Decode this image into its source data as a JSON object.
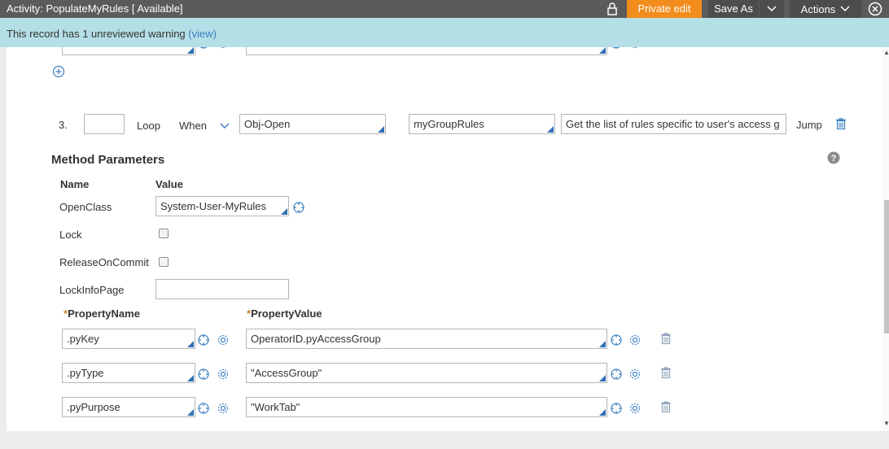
{
  "header": {
    "title": "Activity:  PopulateMyRules [ Available]",
    "private_edit": "Private edit",
    "save_as": "Save As",
    "actions": "Actions"
  },
  "warning": {
    "message": "This record has 1 unreviewed warning ",
    "link": "(view)"
  },
  "step": {
    "number": "3.",
    "loop": "Loop",
    "when": "When",
    "method": "Obj-Open",
    "step_page": "myGroupRules",
    "description": "Get the list of rules specific to user's access g",
    "jump": "Jump"
  },
  "method_params": {
    "title": "Method Parameters",
    "col_name": "Name",
    "col_value": "Value",
    "rows": [
      {
        "name": "OpenClass",
        "value": "System-User-MyRules"
      },
      {
        "name": "Lock"
      },
      {
        "name": "ReleaseOnCommit"
      },
      {
        "name": "LockInfoPage",
        "value": ""
      }
    ]
  },
  "properties": {
    "col_name": "PropertyName",
    "col_value": "PropertyValue",
    "required_mark": "*",
    "rows": [
      {
        "name": ".pyKey",
        "value": "OperatorID.pyAccessGroup"
      },
      {
        "name": ".pyType",
        "value": "\"AccessGroup\""
      },
      {
        "name": ".pyPurpose",
        "value": "\"WorkTab\""
      }
    ]
  },
  "colors": {
    "header_bg": "#5b5b5b",
    "private_edit_bg": "#f28c1c",
    "warning_bg": "#b5dfe6",
    "link": "#3a7fc1",
    "dropdown_corner": "#2f6fb6"
  },
  "icons": [
    "lock-icon",
    "chevron-down-icon",
    "close-icon",
    "add-icon",
    "target-icon",
    "gear-icon",
    "trash-icon",
    "help-icon"
  ]
}
